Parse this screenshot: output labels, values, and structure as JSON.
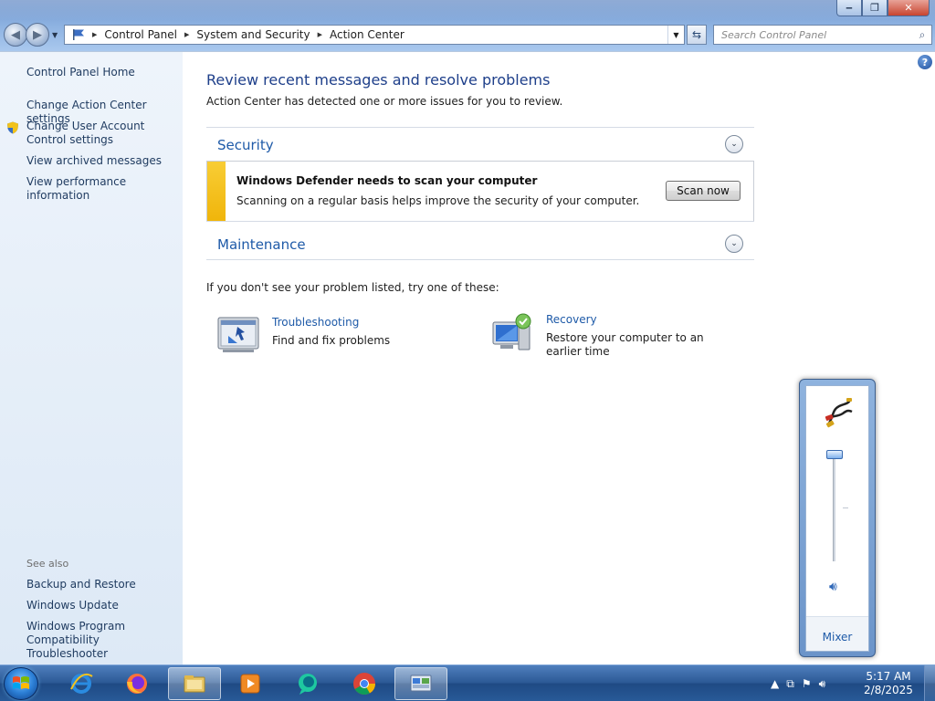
{
  "window": {
    "minimize": "‒",
    "maximize": "❐",
    "close": "✕"
  },
  "address": {
    "crumbs": [
      "Control Panel",
      "System and Security",
      "Action Center"
    ]
  },
  "search": {
    "placeholder": "Search Control Panel"
  },
  "sidebar": {
    "items": [
      {
        "label": "Control Panel Home"
      },
      {
        "label": "Change Action Center settings"
      },
      {
        "label": "Change User Account Control settings"
      },
      {
        "label": "View archived messages"
      },
      {
        "label": "View performance information"
      }
    ],
    "see_also_label": "See also",
    "see_also": [
      {
        "label": "Backup and Restore"
      },
      {
        "label": "Windows Update"
      },
      {
        "label": "Windows Program Compatibility Troubleshooter"
      }
    ]
  },
  "main": {
    "title": "Review recent messages and resolve problems",
    "subtitle": "Action Center has detected one or more issues for you to review.",
    "security_label": "Security",
    "alert": {
      "title": "Windows Defender needs to scan your computer",
      "description": "Scanning on a regular basis helps improve the security of your computer.",
      "button": "Scan now"
    },
    "maintenance_label": "Maintenance",
    "problem_prompt": "If you don't see your problem listed, try one of these:",
    "tools": [
      {
        "link": "Troubleshooting",
        "desc": "Find and fix problems"
      },
      {
        "link": "Recovery",
        "desc": "Restore your computer to an earlier time"
      }
    ],
    "help": "?"
  },
  "volume": {
    "level_fraction": 0.0,
    "mixer": "Mixer"
  },
  "taskbar": {
    "time": "5:17 AM",
    "date": "2/8/2025"
  },
  "colors": {
    "link": "#1e5aa8",
    "alert_stripe": "#f0b50b",
    "sidebar_bg": "#e6eef8"
  }
}
